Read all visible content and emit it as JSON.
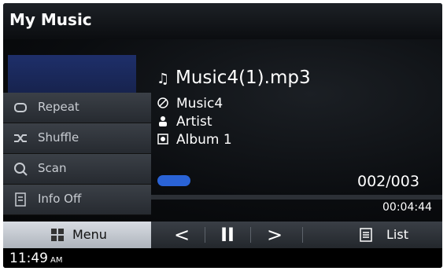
{
  "header": {
    "title": "My Music"
  },
  "sidebar": {
    "items": [
      {
        "label": "Repeat",
        "icon": "repeat-icon"
      },
      {
        "label": "Shuffle",
        "icon": "shuffle-icon"
      },
      {
        "label": "Scan",
        "icon": "scan-icon"
      },
      {
        "label": "Info Off",
        "icon": "info-icon"
      }
    ]
  },
  "track": {
    "filename": "Music4(1).mp3",
    "title": "Music4",
    "artist": "Artist",
    "album": "Album 1",
    "counter": "002/003",
    "elapsed": "00:04:44"
  },
  "bottom": {
    "menu_label": "Menu",
    "prev": "<",
    "pause": "II",
    "next": ">",
    "list_label": "List"
  },
  "status": {
    "time": "11:49",
    "ampm": "AM"
  },
  "colors": {
    "accent_blue": "#2a63d6",
    "background": "#000000"
  }
}
